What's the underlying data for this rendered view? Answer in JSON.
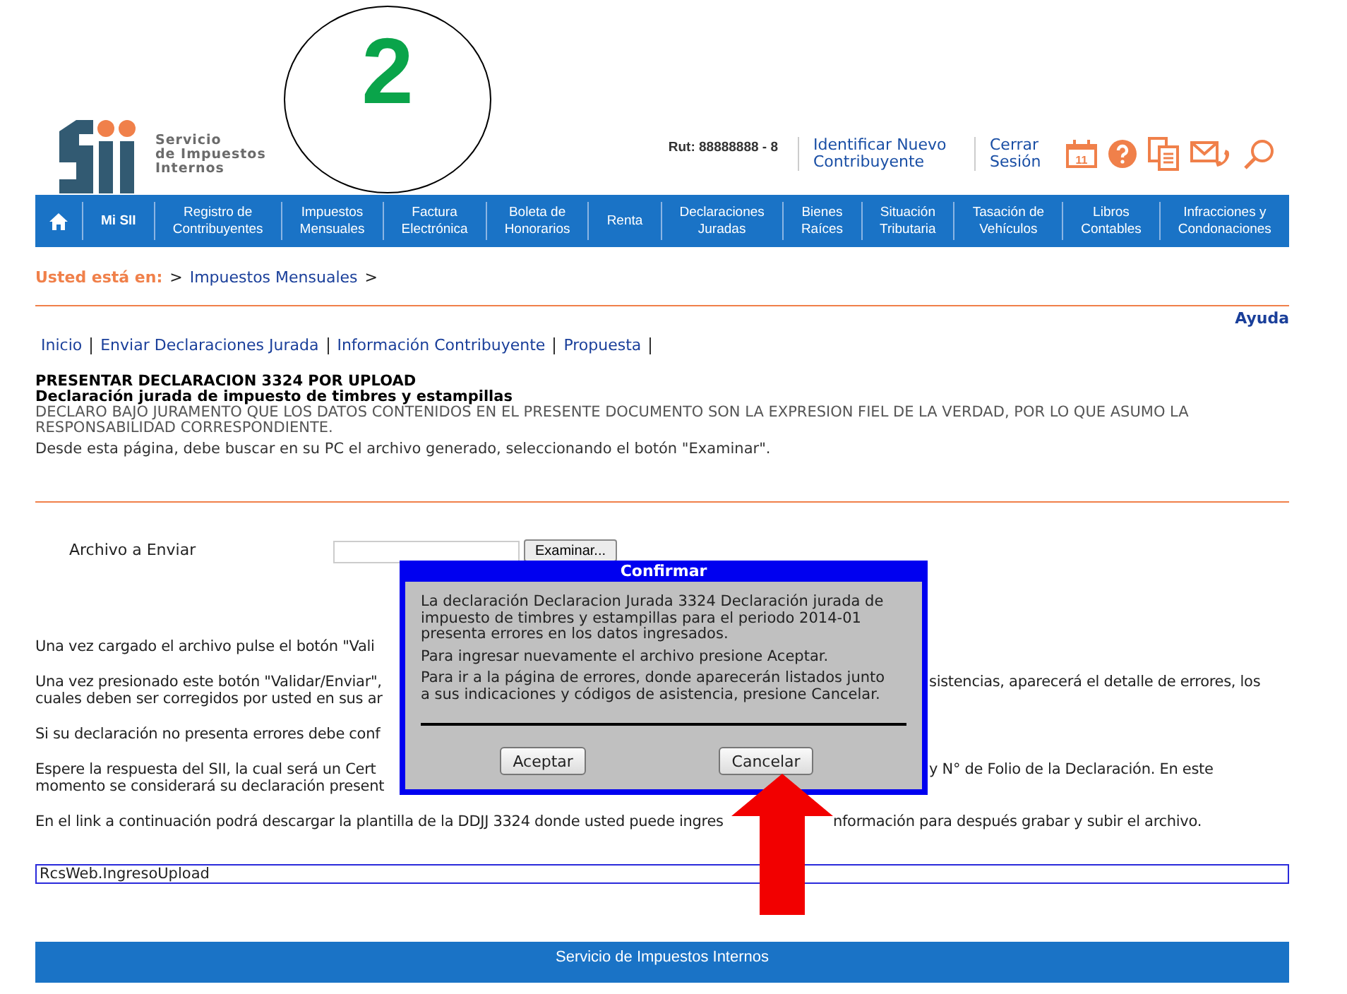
{
  "annotation": {
    "label": "2"
  },
  "logo": {
    "lines": [
      "Servicio",
      "de Impuestos",
      "Internos"
    ]
  },
  "header": {
    "rut": "Rut: 88888888 - 8",
    "links": [
      "Identificar Nuevo Contribuyente",
      "Cerrar Sesión"
    ],
    "calendar_day": "11"
  },
  "nav": [
    {
      "kind": "home"
    },
    {
      "kind": "link",
      "lines": [
        "Mi SII"
      ],
      "bold": true
    },
    {
      "kind": "link",
      "lines": [
        "Registro de",
        "Contribuyentes"
      ],
      "bold": false
    },
    {
      "kind": "link",
      "lines": [
        "Impuestos",
        "Mensuales"
      ],
      "bold": false
    },
    {
      "kind": "link",
      "lines": [
        "Factura",
        "Electrónica"
      ],
      "bold": false
    },
    {
      "kind": "link",
      "lines": [
        "Boleta de",
        "Honorarios"
      ],
      "bold": false
    },
    {
      "kind": "link",
      "lines": [
        "Renta"
      ],
      "bold": false
    },
    {
      "kind": "link",
      "lines": [
        "Declaraciones",
        "Juradas"
      ],
      "bold": false
    },
    {
      "kind": "link",
      "lines": [
        "Bienes",
        "Raíces"
      ],
      "bold": false
    },
    {
      "kind": "link",
      "lines": [
        "Situación",
        "Tributaria"
      ],
      "bold": false
    },
    {
      "kind": "link",
      "lines": [
        "Tasación de",
        "Vehículos"
      ],
      "bold": false
    },
    {
      "kind": "link",
      "lines": [
        "Libros",
        "Contables"
      ],
      "bold": false
    },
    {
      "kind": "link",
      "lines": [
        "Infracciones y",
        "Condonaciones"
      ],
      "bold": false
    }
  ],
  "breadcrumb": {
    "label": "Usted está en:",
    "parts": [
      {
        "kind": "sep",
        "text": ">"
      },
      {
        "kind": "link",
        "text": "Impuestos Mensuales"
      },
      {
        "kind": "sep",
        "text": ">"
      }
    ]
  },
  "help_link": "Ayuda",
  "tabs": [
    "Inicio",
    "Enviar Declaraciones Jurada",
    "Información Contribuyente",
    "Propuesta"
  ],
  "form": {
    "title": "PRESENTAR DECLARACION 3324 POR UPLOAD",
    "subtitle": "Declaración jurada de impuesto de timbres y estampillas",
    "oath": "DECLARO BAJO JURAMENTO QUE LOS DATOS CONTENIDOS EN EL PRESENTE DOCUMENTO SON LA EXPRESION FIEL DE LA VERDAD, POR LO QUE ASUMO LA RESPONSABILIDAD CORRESPONDIENTE.",
    "instruction": "Desde esta página, debe buscar en su PC el archivo generado, seleccionando el botón \"Examinar\"."
  },
  "upload": {
    "label": "Archivo a Enviar",
    "button": "Examinar..."
  },
  "paragraphs": [
    {
      "kind": "behind_dialog",
      "lines": [
        {
          "left": "Una vez cargado el archivo pulse el botón \"Vali"
        }
      ]
    },
    {
      "kind": "behind_dialog",
      "lines": [
        {
          "left": "Una vez presionado este botón \"Validar/Enviar\",",
          "right": "sistencias, aparecerá el detalle de errores, los"
        },
        {
          "left": "cuales deben ser corregidos por usted en sus ar"
        }
      ]
    },
    {
      "kind": "behind_dialog",
      "lines": [
        {
          "left": "Si su declaración no presenta errores debe conf"
        }
      ]
    },
    {
      "kind": "behind_dialog",
      "lines": [
        {
          "left": "Espere la respuesta del SII, la cual será un Cert",
          "right": "y N° de Folio de la Declaración. En este"
        },
        {
          "left": "momento se considerará su declaración present"
        }
      ]
    },
    {
      "kind": "behind_arrow",
      "lines": [
        {
          "left": "En el link a continuación podrá descargar la plantilla de la DDJJ 3324 donde usted puede ingres",
          "right": "nformación para después grabar y subir el archivo."
        }
      ]
    }
  ],
  "link_box": "RcsWeb.IngresoUpload",
  "dialog": {
    "title": "Confirmar",
    "paragraphs": [
      "La declaración Declaracion Jurada 3324 Declaración jurada de impuesto de timbres y estampillas para el periodo 2014-01 presenta errores en los datos ingresados.",
      "Para ingresar nuevamente el archivo presione Aceptar.",
      "Para ir a la página de errores, donde aparecerán listados junto a sus indicaciones y códigos de asistencia, presione Cancelar."
    ],
    "buttons": [
      "Aceptar",
      "Cancelar"
    ]
  },
  "footer": "Servicio de Impuestos Internos"
}
